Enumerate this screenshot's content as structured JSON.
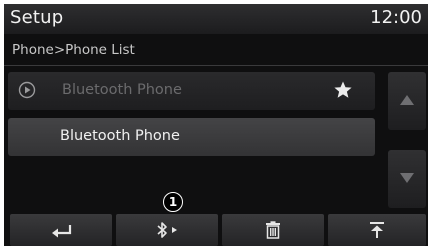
{
  "header": {
    "title": "Setup",
    "clock": "12:00"
  },
  "breadcrumb": "Phone>Phone List",
  "list": {
    "items": [
      {
        "label": "Bluetooth Phone",
        "icon": "play-circle-icon",
        "favorite": true,
        "state": "dimmed"
      },
      {
        "label": "Bluetooth Phone",
        "state": "highlighted"
      }
    ]
  },
  "scroll": {
    "up_icon": "triangle-up-icon",
    "down_icon": "triangle-down-icon"
  },
  "bottom_bar": {
    "buttons": [
      {
        "name": "back",
        "icon": "back-arrow-icon"
      },
      {
        "name": "bluetooth-connect",
        "icon": "bluetooth-icon"
      },
      {
        "name": "delete",
        "icon": "trash-icon"
      },
      {
        "name": "move-to-top",
        "icon": "move-top-icon"
      }
    ]
  },
  "callout": {
    "number": "1"
  },
  "colors": {
    "background": "#0f0f10",
    "text": "#f2f2f2",
    "dimmed_text": "#6b6b6d",
    "highlight_row": "#3c3c3e",
    "arrow": "#6f6f72"
  }
}
